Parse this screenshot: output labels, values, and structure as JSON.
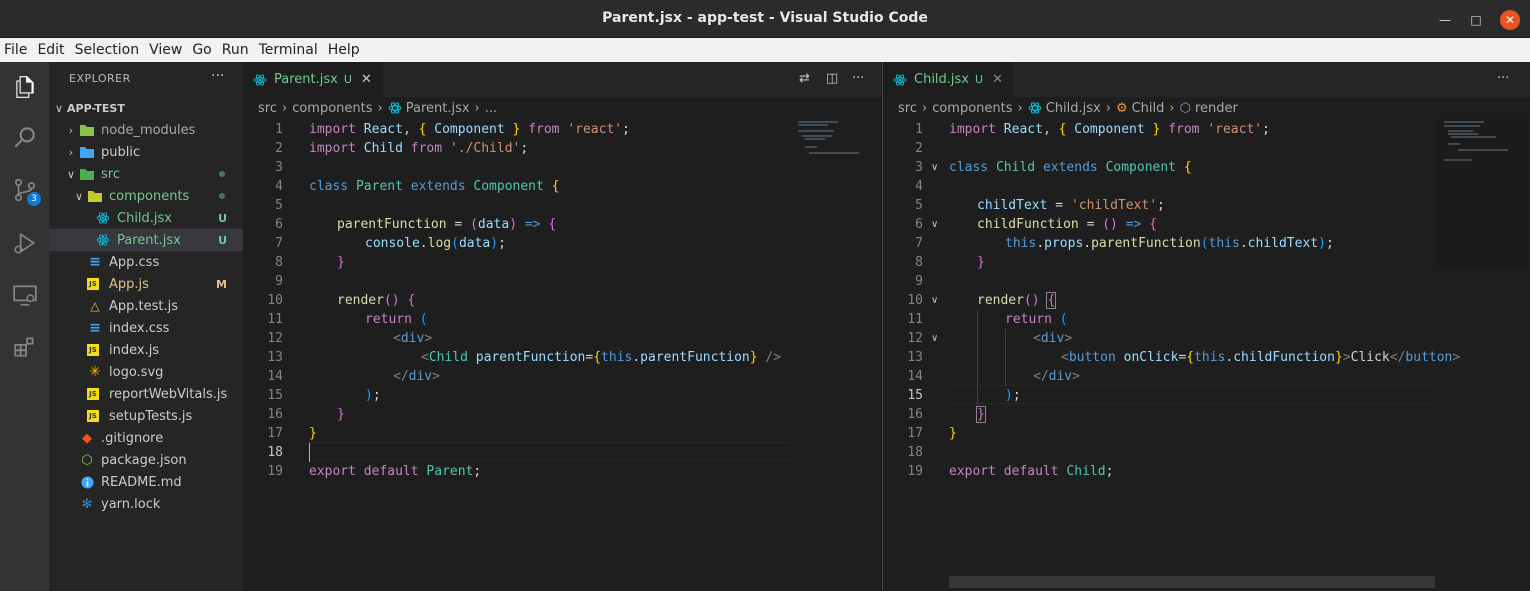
{
  "window": {
    "title": "Parent.jsx - app-test - Visual Studio Code"
  },
  "menu": [
    "File",
    "Edit",
    "Selection",
    "View",
    "Go",
    "Run",
    "Terminal",
    "Help"
  ],
  "activity": {
    "scm_badge": "3"
  },
  "explorer": {
    "header": "EXPLORER",
    "more": "···",
    "project": "APP-TEST",
    "items": [
      {
        "label": "node_modules",
        "git": ""
      },
      {
        "label": "public",
        "git": ""
      },
      {
        "label": "src",
        "git": ""
      },
      {
        "label": "components",
        "git": ""
      },
      {
        "label": "Child.jsx",
        "git": "U"
      },
      {
        "label": "Parent.jsx",
        "git": "U"
      },
      {
        "label": "App.css",
        "git": ""
      },
      {
        "label": "App.js",
        "git": "M"
      },
      {
        "label": "App.test.js",
        "git": ""
      },
      {
        "label": "index.css",
        "git": ""
      },
      {
        "label": "index.js",
        "git": ""
      },
      {
        "label": "logo.svg",
        "git": ""
      },
      {
        "label": "reportWebVitals.js",
        "git": ""
      },
      {
        "label": "setupTests.js",
        "git": ""
      },
      {
        "label": ".gitignore",
        "git": ""
      },
      {
        "label": "package.json",
        "git": ""
      },
      {
        "label": "README.md",
        "git": ""
      },
      {
        "label": "yarn.lock",
        "git": ""
      }
    ]
  },
  "left_editor": {
    "tab": {
      "name": "Parent.jsx",
      "status": "U",
      "close": "✕"
    },
    "breadcrumb": {
      "a": "src",
      "b": "components",
      "c": "Parent.jsx",
      "d": "..."
    },
    "line_numbers": [
      "1",
      "2",
      "3",
      "4",
      "5",
      "6",
      "7",
      "8",
      "9",
      "10",
      "11",
      "12",
      "13",
      "14",
      "15",
      "16",
      "17",
      "18",
      "19"
    ],
    "active_line": "18"
  },
  "right_editor": {
    "tab": {
      "name": "Child.jsx",
      "status": "U",
      "close": "✕"
    },
    "breadcrumb": {
      "a": "src",
      "b": "components",
      "c": "Child.jsx",
      "d": "Child",
      "e": "render"
    },
    "line_numbers": [
      "1",
      "2",
      "3",
      "4",
      "5",
      "6",
      "7",
      "8",
      "9",
      "10",
      "11",
      "12",
      "13",
      "14",
      "15",
      "16",
      "17",
      "18",
      "19"
    ],
    "active_line": "15"
  },
  "colors": {
    "accent": "#0e7ad1",
    "untracked": "#73c991",
    "modified": "#e2c08d",
    "close_btn": "#e95420"
  }
}
